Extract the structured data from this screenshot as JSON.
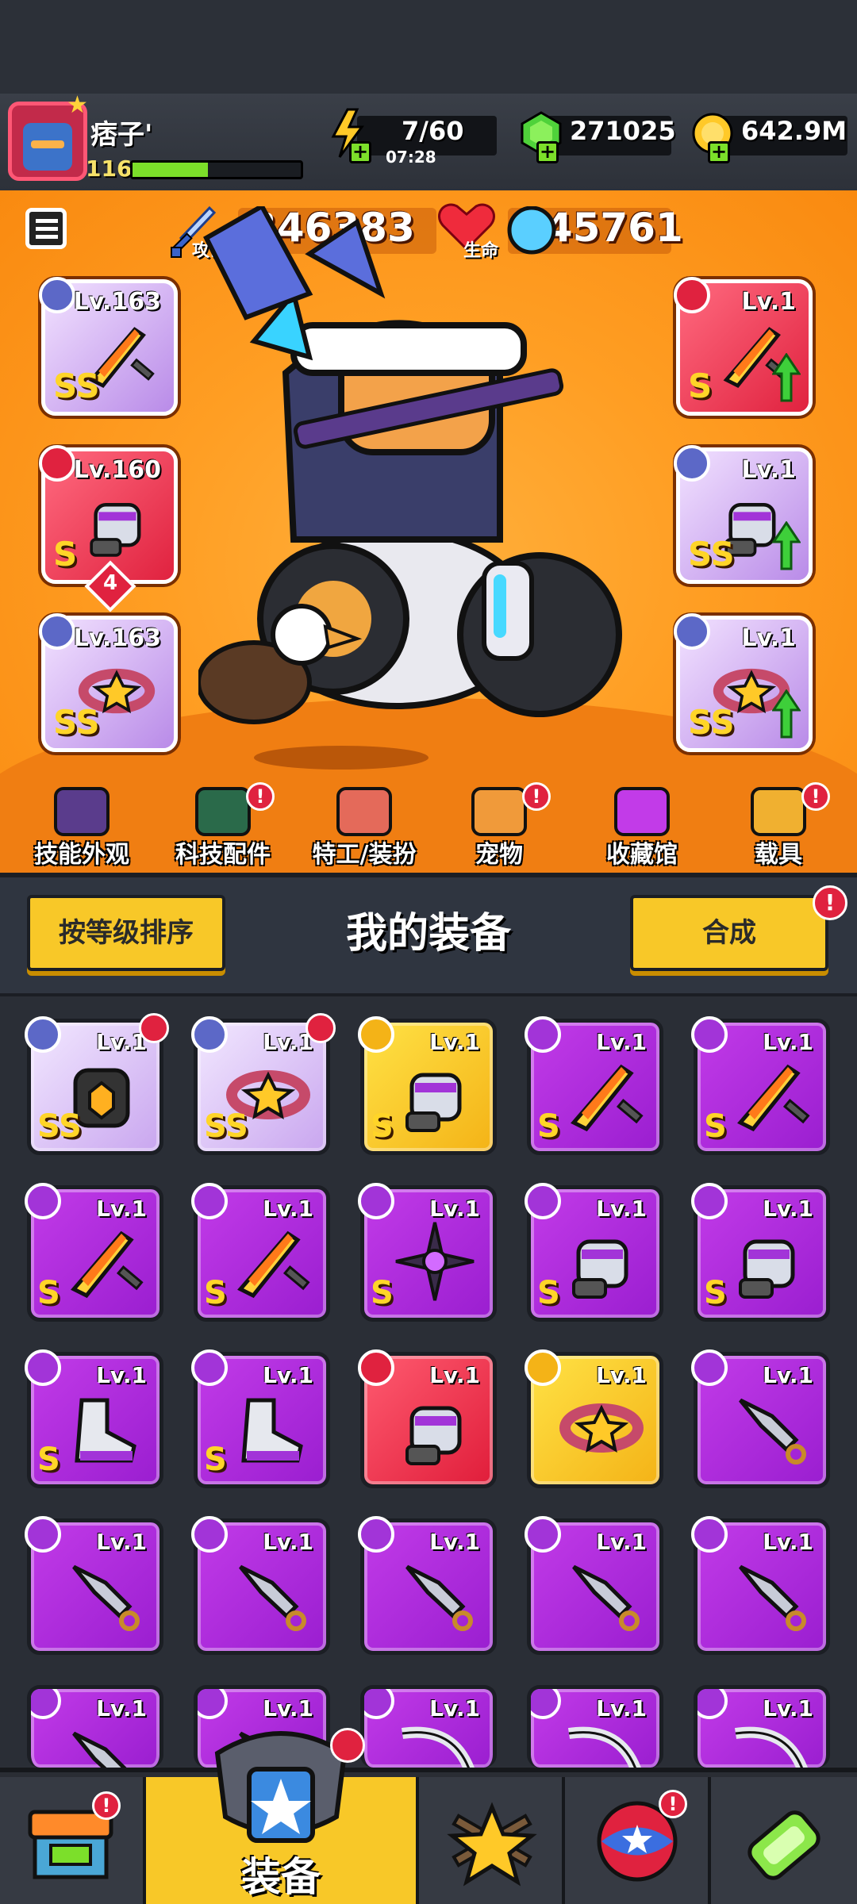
{
  "player": {
    "name": "痞子'",
    "level": "116",
    "xp_fraction": 0.45
  },
  "resources": {
    "energy": "7/60",
    "energy_timer": "07:28",
    "gems": "271025",
    "coins": "642.9M"
  },
  "stats": {
    "attack_label": "攻击",
    "attack_value": "346383",
    "hp_label": "生命",
    "hp_value": "945761"
  },
  "equipped": {
    "left": [
      {
        "level": "Lv.163",
        "rank": "SS",
        "color": "purple-light",
        "icon": "weapon-icon",
        "art": "staff-weapon-icon"
      },
      {
        "level": "Lv.160",
        "rank": "S",
        "color": "red",
        "icon": "necklace-icon",
        "art": "chain-necklace-icon",
        "stars": "4"
      },
      {
        "level": "Lv.163",
        "rank": "SS",
        "color": "purple-light",
        "icon": "glove-icon",
        "art": "gauntlet-icon"
      }
    ],
    "right": [
      {
        "level": "Lv.1",
        "rank": "S",
        "color": "red",
        "icon": "armor-icon",
        "art": "chest-armor-icon"
      },
      {
        "level": "Lv.1",
        "rank": "SS",
        "color": "purple-light",
        "icon": "belt-icon",
        "art": "belt-item-icon"
      },
      {
        "level": "Lv.1",
        "rank": "SS",
        "color": "purple-light",
        "icon": "boots-icon",
        "art": "boots-item-icon"
      }
    ]
  },
  "features": [
    {
      "label": "技能外观",
      "icon": "skill-skin-icon",
      "notif": false
    },
    {
      "label": "科技配件",
      "icon": "tech-part-icon",
      "notif": true
    },
    {
      "label": "特工/装扮",
      "icon": "agent-outfit-icon",
      "notif": false
    },
    {
      "label": "宠物",
      "icon": "pet-icon",
      "notif": true
    },
    {
      "label": "收藏馆",
      "icon": "collection-icon",
      "notif": false
    },
    {
      "label": "载具",
      "icon": "vehicle-icon",
      "notif": true
    }
  ],
  "bag": {
    "sort_label": "按等级排序",
    "title": "我的装备",
    "merge_label": "合成",
    "merge_notif": "!"
  },
  "items": [
    {
      "level": "Lv.1",
      "rank": "SS",
      "color": "light",
      "badge": "blue",
      "art": "armor",
      "notif": true
    },
    {
      "level": "Lv.1",
      "rank": "SS",
      "color": "light",
      "badge": "blue",
      "art": "belt",
      "notif": true
    },
    {
      "level": "Lv.1",
      "rank": "S",
      "color": "gold",
      "badge": "gold",
      "art": "glove",
      "notif": false
    },
    {
      "level": "Lv.1",
      "rank": "S",
      "color": "purple",
      "badge": "purple",
      "art": "sword",
      "notif": false
    },
    {
      "level": "Lv.1",
      "rank": "S",
      "color": "purple",
      "badge": "purple",
      "art": "sword",
      "notif": false
    },
    {
      "level": "Lv.1",
      "rank": "S",
      "color": "purple",
      "badge": "purple",
      "art": "sword",
      "notif": false
    },
    {
      "level": "Lv.1",
      "rank": "S",
      "color": "purple",
      "badge": "purple",
      "art": "sword",
      "notif": false
    },
    {
      "level": "Lv.1",
      "rank": "S",
      "color": "purple",
      "badge": "purple",
      "art": "shuriken",
      "notif": false
    },
    {
      "level": "Lv.1",
      "rank": "S",
      "color": "purple",
      "badge": "purple",
      "art": "glove",
      "notif": false
    },
    {
      "level": "Lv.1",
      "rank": "S",
      "color": "purple",
      "badge": "purple",
      "art": "glove",
      "notif": false
    },
    {
      "level": "Lv.1",
      "rank": "S",
      "color": "purple",
      "badge": "purple",
      "art": "boots",
      "notif": false
    },
    {
      "level": "Lv.1",
      "rank": "S",
      "color": "purple",
      "badge": "purple",
      "art": "boots",
      "notif": false
    },
    {
      "level": "Lv.1",
      "rank": "",
      "color": "red",
      "badge": "red",
      "art": "glove",
      "notif": false
    },
    {
      "level": "Lv.1",
      "rank": "",
      "color": "gold",
      "badge": "gold",
      "art": "belt",
      "notif": false
    },
    {
      "level": "Lv.1",
      "rank": "",
      "color": "purple",
      "badge": "purple",
      "art": "kunai",
      "notif": false
    },
    {
      "level": "Lv.1",
      "rank": "",
      "color": "purple",
      "badge": "purple",
      "art": "kunai",
      "notif": false
    },
    {
      "level": "Lv.1",
      "rank": "",
      "color": "purple",
      "badge": "purple",
      "art": "kunai",
      "notif": false
    },
    {
      "level": "Lv.1",
      "rank": "",
      "color": "purple",
      "badge": "purple",
      "art": "kunai",
      "notif": false
    },
    {
      "level": "Lv.1",
      "rank": "",
      "color": "purple",
      "badge": "purple",
      "art": "kunai",
      "notif": false
    },
    {
      "level": "Lv.1",
      "rank": "",
      "color": "purple",
      "badge": "purple",
      "art": "kunai",
      "notif": false
    },
    {
      "level": "Lv.1",
      "rank": "",
      "color": "purple",
      "badge": "purple",
      "art": "kunai",
      "notif": false
    },
    {
      "level": "Lv.1",
      "rank": "",
      "color": "purple",
      "badge": "purple",
      "art": "kunai",
      "notif": false
    },
    {
      "level": "Lv.1",
      "rank": "",
      "color": "purple",
      "badge": "purple",
      "art": "scythe",
      "notif": false
    },
    {
      "level": "Lv.1",
      "rank": "",
      "color": "purple",
      "badge": "purple",
      "art": "scythe",
      "notif": false
    },
    {
      "level": "Lv.1",
      "rank": "",
      "color": "purple",
      "badge": "purple",
      "art": "scythe",
      "notif": false
    }
  ],
  "nav": {
    "active_label": "装备",
    "tabs": [
      {
        "icon": "shop-icon",
        "notif": true
      },
      {
        "icon": "equipment-icon",
        "notif": true
      },
      {
        "icon": "talent-star-icon",
        "notif": false
      },
      {
        "icon": "world-orb-icon",
        "notif": true
      },
      {
        "icon": "gene-capsule-icon",
        "notif": false
      }
    ]
  },
  "colors": {
    "accent": "#f8c828",
    "purple": "#a234d8",
    "red": "#e0223f",
    "green": "#7cdf2a"
  }
}
